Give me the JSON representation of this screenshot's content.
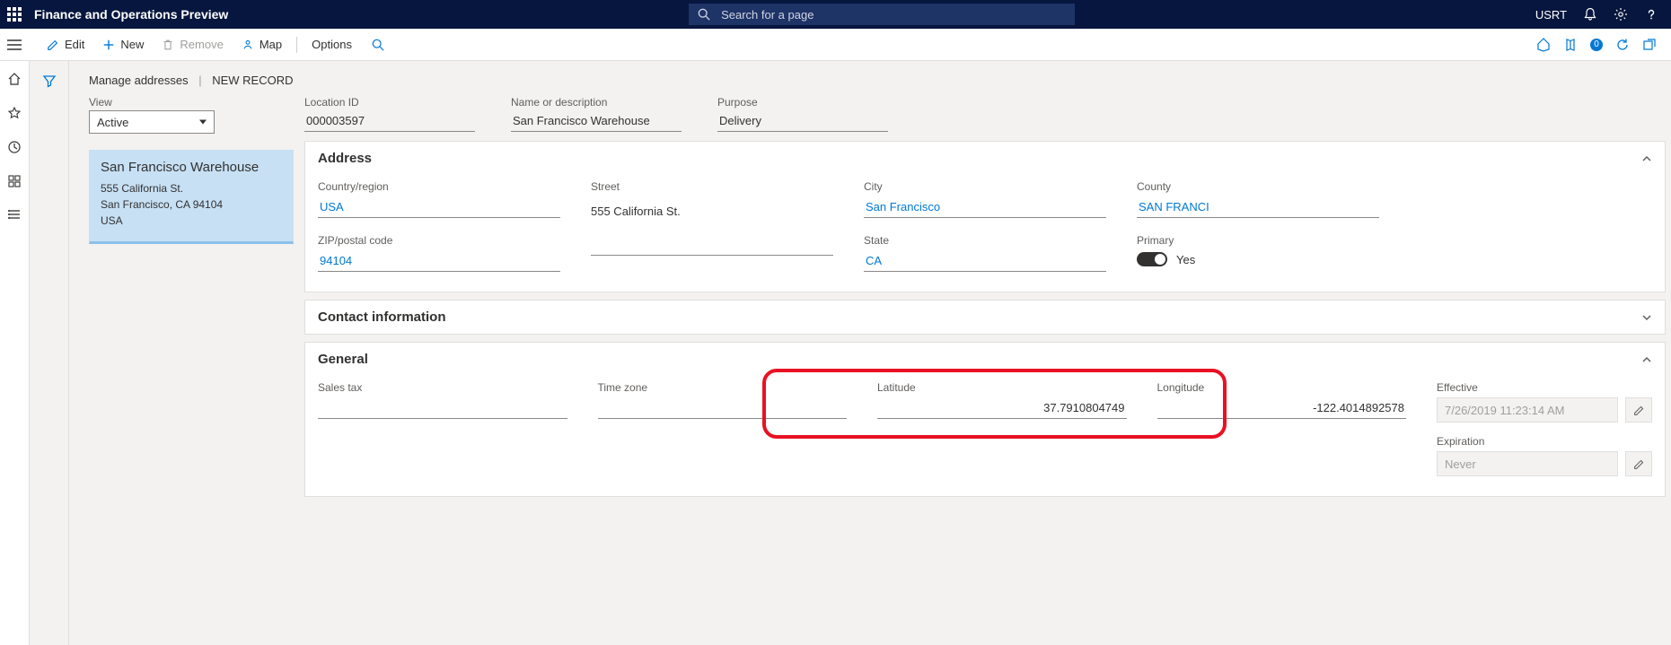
{
  "nav": {
    "app_title": "Finance and Operations Preview",
    "search_placeholder": "Search for a page",
    "user": "USRT"
  },
  "toolbar": {
    "edit": "Edit",
    "new": "New",
    "remove": "Remove",
    "map": "Map",
    "options": "Options",
    "badge": "0"
  },
  "breadcrumb": {
    "a": "Manage addresses",
    "b": "NEW RECORD"
  },
  "view": {
    "label": "View",
    "value": "Active"
  },
  "card": {
    "title": "San Francisco Warehouse",
    "l1": "555 California St.",
    "l2": "San Francisco, CA 94104",
    "l3": "USA"
  },
  "header": {
    "location_id": {
      "label": "Location ID",
      "value": "000003597"
    },
    "name": {
      "label": "Name or description",
      "value": "San Francisco Warehouse"
    },
    "purpose": {
      "label": "Purpose",
      "value": "Delivery"
    }
  },
  "sections": {
    "address": "Address",
    "contact": "Contact information",
    "general": "General"
  },
  "address": {
    "country": {
      "label": "Country/region",
      "value": "USA"
    },
    "street": {
      "label": "Street",
      "value": "555 California St."
    },
    "city": {
      "label": "City",
      "value": "San Francisco"
    },
    "county": {
      "label": "County",
      "value": "SAN FRANCI"
    },
    "zip": {
      "label": "ZIP/postal code",
      "value": "94104"
    },
    "state": {
      "label": "State",
      "value": "CA"
    },
    "primary": {
      "label": "Primary",
      "text": "Yes"
    }
  },
  "general": {
    "salestax": {
      "label": "Sales tax",
      "value": ""
    },
    "timezone": {
      "label": "Time zone",
      "value": ""
    },
    "latitude": {
      "label": "Latitude",
      "value": "37.7910804749"
    },
    "longitude": {
      "label": "Longitude",
      "value": "-122.4014892578"
    },
    "effective": {
      "label": "Effective",
      "value": "7/26/2019 11:23:14 AM"
    },
    "expiration": {
      "label": "Expiration",
      "value": "Never"
    }
  }
}
